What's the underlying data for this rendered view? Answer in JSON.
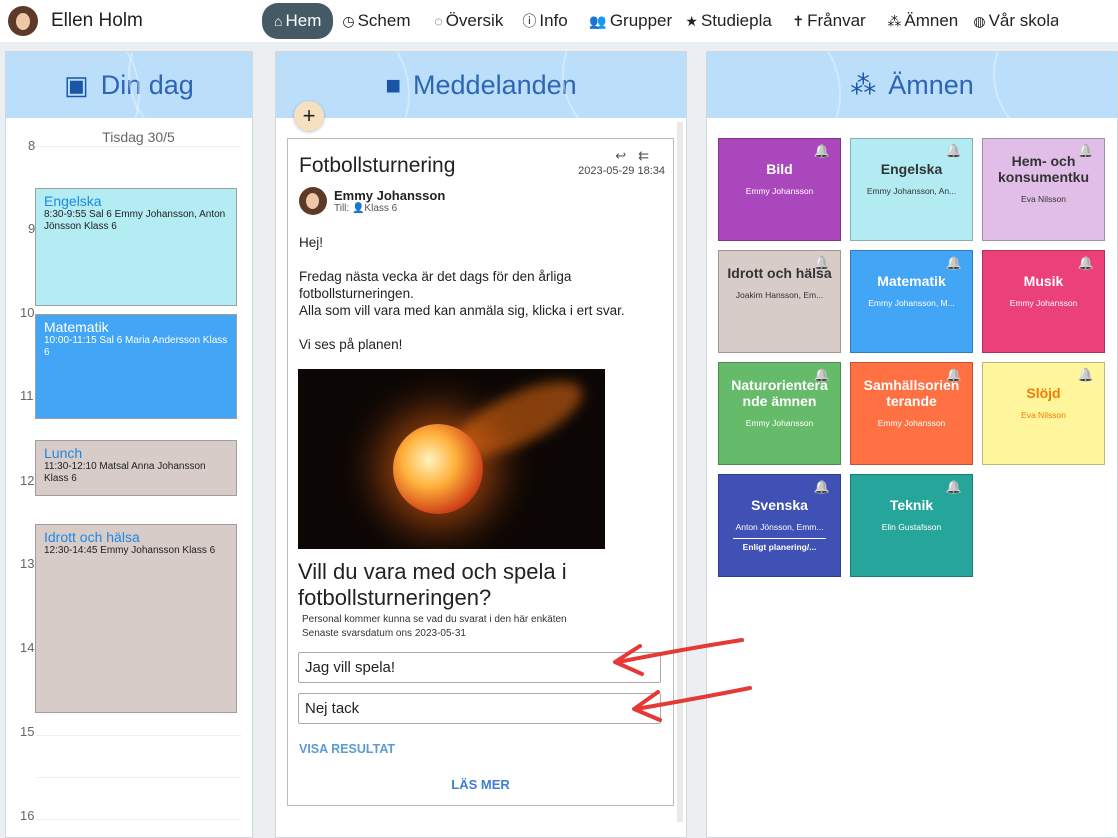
{
  "user": {
    "name": "Ellen Holm"
  },
  "nav": [
    {
      "icon": "⌂",
      "label": "Hem",
      "active": true
    },
    {
      "icon": "◷",
      "label": "Schem"
    },
    {
      "icon": "◌",
      "label": "Översik"
    },
    {
      "icon": "ⓘ",
      "label": "Info"
    },
    {
      "icon": "👥",
      "label": "Grupper"
    },
    {
      "icon": "★",
      "label": "Studiepla"
    },
    {
      "icon": "✝",
      "label": "Frånvar"
    },
    {
      "icon": "⁂",
      "label": "Ämnen"
    },
    {
      "icon": "◍",
      "label": "Vår skola"
    }
  ],
  "day": {
    "title": "Din dag",
    "date": "Tisdag 30/5",
    "hours": [
      "8",
      "9",
      "10",
      "11",
      "12",
      "13",
      "14",
      "15",
      "16"
    ],
    "events": [
      {
        "title": "Engelska",
        "detail": "8:30-9:55 Sal 6 Emmy Johansson, Anton Jönsson  Klass 6",
        "color": "#b3ecf2"
      },
      {
        "title": "Matematik",
        "detail": "10:00-11:15 Sal 6 Maria Andersson Klass 6",
        "color": "#42a5f5"
      },
      {
        "title": "Lunch",
        "detail": "11:30-12:10 Matsal Anna Johansson Klass 6",
        "color": "#d7ccc8"
      },
      {
        "title": "Idrott och hälsa",
        "detail": "12:30-14:45  Emmy Johansson Klass 6",
        "color": "#d7ccc8"
      }
    ]
  },
  "messages": {
    "title": "Meddelanden",
    "add_label": "+",
    "post": {
      "title": "Fotbollsturnering",
      "date": "2023-05-29 18:34",
      "sender": "Emmy Johansson",
      "to_label": "Till:",
      "to": "Klass 6",
      "greeting": "Hej!",
      "body1": "Fredag nästa vecka är det dags för den årliga fotbollsturneringen.",
      "body2": "Alla som vill vara med kan anmäla sig, klicka i ert svar.",
      "closing": "Vi ses på planen!",
      "question": "Vill du vara med och spela i fotbollsturneringen?",
      "note1": "Personal kommer kunna se vad du svarat i den här enkäten",
      "note2": "Senaste svarsdatum ons 2023-05-31",
      "option1": "Jag vill spela!",
      "option2": "Nej tack",
      "show_results": "VISA RESULTAT",
      "read_more": "LÄS MER"
    }
  },
  "subjects": {
    "title": "Ämnen",
    "items": [
      {
        "name": "Bild",
        "teacher": "Emmy Johansson",
        "color": "#ab47bc",
        "bell": "#ffffff",
        "dark": false
      },
      {
        "name": "Engelska",
        "teacher": "Emmy Johansson, An...",
        "color": "#b2ebf2",
        "bell": "#00695c",
        "dark": true
      },
      {
        "name": "Hem- och konsumentku",
        "teacher": "Eva Nilsson",
        "color": "#e1bee7",
        "bell": "#ffffff",
        "dark": true
      },
      {
        "name": "Idrott och hälsa",
        "teacher": "Joakim Hansson, Em...",
        "color": "#d7ccc8",
        "bell": "#333333",
        "dark": true
      },
      {
        "name": "Matematik",
        "teacher": "Emmy Johansson, M...",
        "color": "#42a5f5",
        "bell": "#ffffff",
        "dark": false
      },
      {
        "name": "Musik",
        "teacher": "Emmy Johansson",
        "color": "#ec407a",
        "bell": "#ffffff",
        "dark": false
      },
      {
        "name": "Naturorientera nde ämnen",
        "teacher": "Emmy Johansson",
        "color": "#66bb6a",
        "bell": "#ffffff",
        "dark": false
      },
      {
        "name": "Samhällsorien terande",
        "teacher": "Emmy Johansson",
        "color": "#ff7043",
        "bell": "#ffffff",
        "dark": false
      },
      {
        "name": "Slöjd",
        "teacher": "Eva Nilsson",
        "color": "#fff59d",
        "bell": "#f57c00",
        "dark": true,
        "accent": "#f57c00"
      },
      {
        "name": "Svenska",
        "teacher": "Anton Jönsson, Emm...",
        "extra": "Enligt planering/...",
        "color": "#3f51b5",
        "bell": "#ffffff",
        "dark": false
      },
      {
        "name": "Teknik",
        "teacher": "Elin Gustafsson",
        "color": "#26a69a",
        "bell": "#ffffff",
        "dark": false
      }
    ]
  }
}
